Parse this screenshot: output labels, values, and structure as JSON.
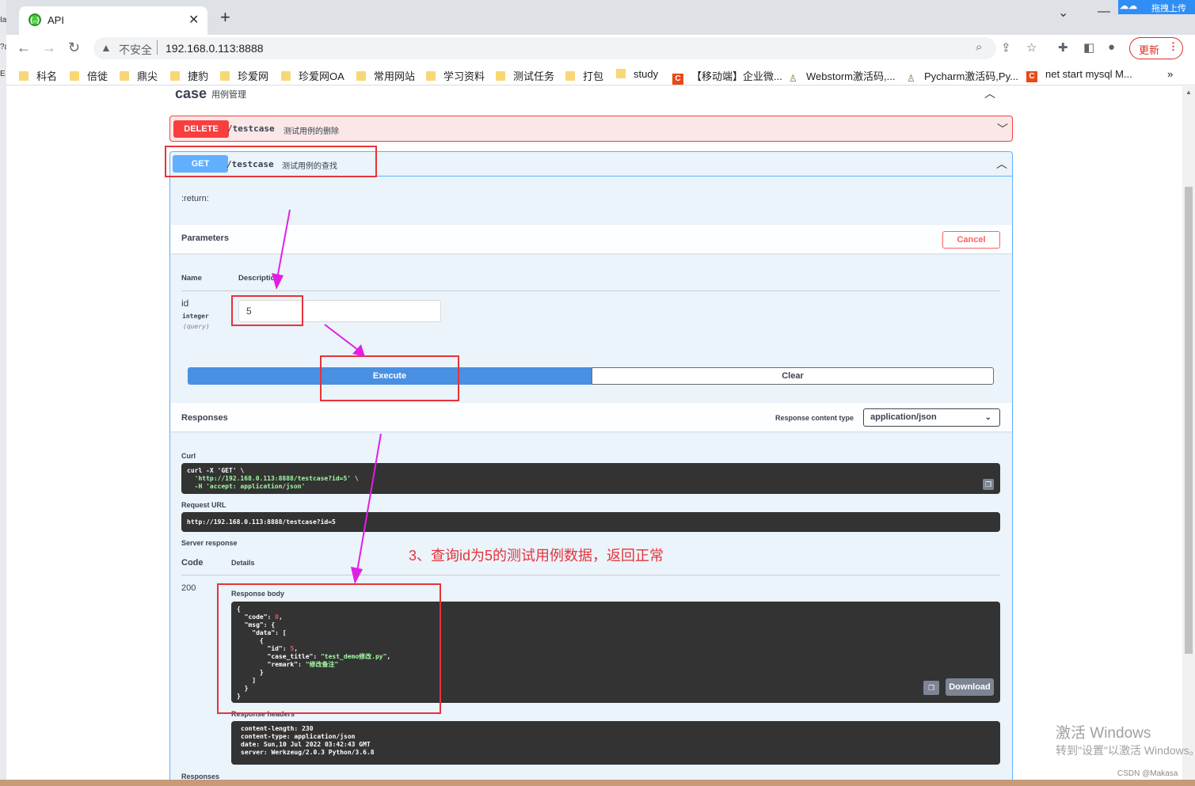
{
  "browser": {
    "tab_title": "API",
    "tab_icon_text": "{..}",
    "address_insecure": "不安全",
    "url": "192.168.0.113:8888",
    "update_label": "更新",
    "baidu_label": "拖拽上传",
    "background_window_fragments": [
      "Ia",
      "?ạ",
      "E"
    ]
  },
  "bookmarks": [
    {
      "label": "科名",
      "icon": "folder-icon"
    },
    {
      "label": "倍徙",
      "icon": "folder-icon"
    },
    {
      "label": "鼎尖",
      "icon": "folder-icon"
    },
    {
      "label": "捷豹",
      "icon": "folder-icon"
    },
    {
      "label": "珍爱网",
      "icon": "folder-icon"
    },
    {
      "label": "珍爱网OA",
      "icon": "folder-icon"
    },
    {
      "label": "常用网站",
      "icon": "folder-icon"
    },
    {
      "label": "学习资料",
      "icon": "folder-icon"
    },
    {
      "label": "测试任务",
      "icon": "folder-icon"
    },
    {
      "label": "打包",
      "icon": "folder-icon"
    },
    {
      "label": "study",
      "icon": "folder-icon"
    },
    {
      "label": "【移动端】企业微...",
      "icon": "csdn-icon"
    },
    {
      "label": "Webstorm激活码,...",
      "icon": "person-icon"
    },
    {
      "label": "Pycharm激活码,Py...",
      "icon": "person-icon"
    },
    {
      "label": "net start mysql M...",
      "icon": "csdn-icon"
    }
  ],
  "bookmarks_more": "»",
  "swagger": {
    "tag_name": "case",
    "tag_desc": "用例管理",
    "delete_op": {
      "method": "DELETE",
      "path": "/testcase",
      "summary": "测试用例的删除"
    },
    "get_op": {
      "method": "GET",
      "path": "/testcase",
      "summary": "测试用例的查找"
    },
    "return_text": ":return:",
    "parameters_title": "Parameters",
    "cancel_label": "Cancel",
    "col_name": "Name",
    "col_desc": "Description",
    "param": {
      "name": "id",
      "type": "integer",
      "in": "(query)",
      "value": "5"
    },
    "execute_label": "Execute",
    "clear_label": "Clear",
    "responses_title": "Responses",
    "response_content_type_label": "Response content type",
    "response_content_type": "application/json",
    "curl_label": "Curl",
    "curl_lines": [
      "curl -X 'GET' \\",
      "  'http://192.168.0.113:8888/testcase?id=5' \\",
      "  -H 'accept: application/json'"
    ],
    "request_url_label": "Request URL",
    "request_url": "http://192.168.0.113:8888/testcase?id=5",
    "server_response_label": "Server response",
    "code_head": "Code",
    "details_head": "Details",
    "status_code": "200",
    "response_body_label": "Response body",
    "response_body": {
      "code": "0",
      "id": "5",
      "case_title": "\"test_demo修改.py\"",
      "remark": "\"修改备注\""
    },
    "download_label": "Download",
    "response_headers_label": "Response headers",
    "response_headers": [
      "content-length: 230",
      "content-type: application/json",
      "date: Sun,10 Jul 2022 03:42:43 GMT",
      "server: Werkzeug/2.0.3 Python/3.6.8"
    ],
    "responses_bottom": "Responses"
  },
  "annotation": "3、查询id为5的测试用例数据，返回正常",
  "watermark": {
    "line1": "激活 Windows",
    "line2": "转到\"设置\"以激活 Windows。",
    "csdn": "CSDN @Makasa"
  },
  "colors": {
    "get": "#61affe",
    "delete": "#f93e3e",
    "execute": "#4990e2",
    "annotation": "#e5343a",
    "arrow": "#e21ee5"
  }
}
